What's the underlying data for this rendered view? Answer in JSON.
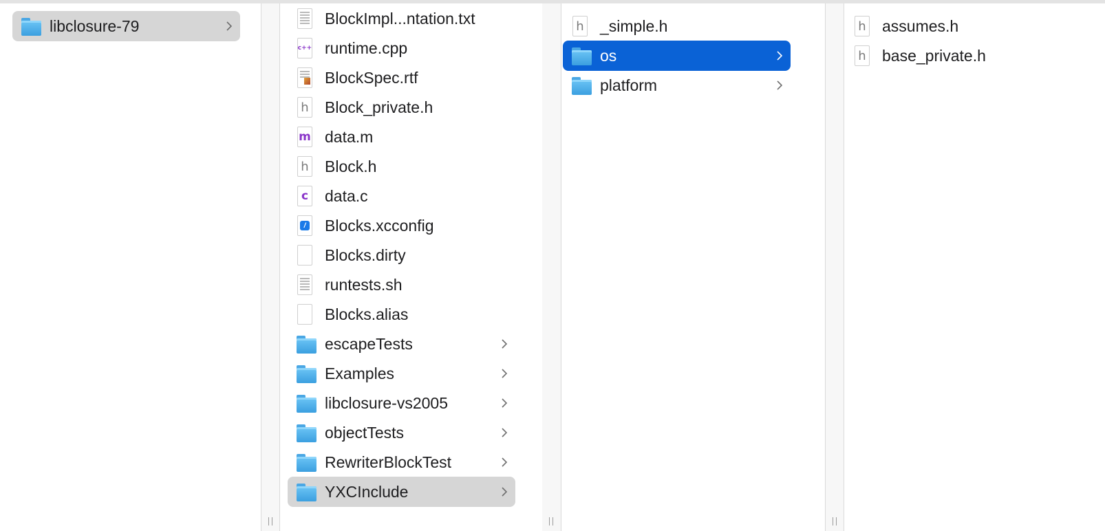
{
  "columns": [
    {
      "items": [
        {
          "label": "libclosure-79",
          "icon": "folder-icon",
          "has_children": true,
          "selected": "gray"
        }
      ]
    },
    {
      "items": [
        {
          "label": "BlockImpl...ntation.txt",
          "icon": "text-file-icon"
        },
        {
          "label": "runtime.cpp",
          "icon": "cpp-file-icon"
        },
        {
          "label": "BlockSpec.rtf",
          "icon": "rtf-file-icon"
        },
        {
          "label": "Block_private.h",
          "icon": "header-file-icon"
        },
        {
          "label": "data.m",
          "icon": "objc-file-icon"
        },
        {
          "label": "Block.h",
          "icon": "header-file-icon"
        },
        {
          "label": "data.c",
          "icon": "c-file-icon"
        },
        {
          "label": "Blocks.xcconfig",
          "icon": "xcconfig-file-icon"
        },
        {
          "label": "Blocks.dirty",
          "icon": "blank-file-icon"
        },
        {
          "label": "runtests.sh",
          "icon": "text-file-icon"
        },
        {
          "label": "Blocks.alias",
          "icon": "blank-file-icon"
        },
        {
          "label": "escapeTests",
          "icon": "folder-icon",
          "has_children": true
        },
        {
          "label": "Examples",
          "icon": "folder-icon",
          "has_children": true
        },
        {
          "label": "libclosure-vs2005",
          "icon": "folder-icon",
          "has_children": true
        },
        {
          "label": "objectTests",
          "icon": "folder-icon",
          "has_children": true
        },
        {
          "label": "RewriterBlockTest",
          "icon": "folder-icon",
          "has_children": true
        },
        {
          "label": "YXCInclude",
          "icon": "folder-icon",
          "has_children": true,
          "selected": "gray"
        }
      ]
    },
    {
      "items": [
        {
          "label": "_simple.h",
          "icon": "header-file-icon"
        },
        {
          "label": "os",
          "icon": "folder-icon",
          "has_children": true,
          "selected": "blue"
        },
        {
          "label": "platform",
          "icon": "folder-icon",
          "has_children": true
        }
      ]
    },
    {
      "items": [
        {
          "label": "assumes.h",
          "icon": "header-file-icon"
        },
        {
          "label": "base_private.h",
          "icon": "header-file-icon"
        }
      ]
    }
  ],
  "colors": {
    "selection_blue": "#0a62d6",
    "selection_gray": "#d6d6d6",
    "folder_blue": "#4aa7e4"
  }
}
